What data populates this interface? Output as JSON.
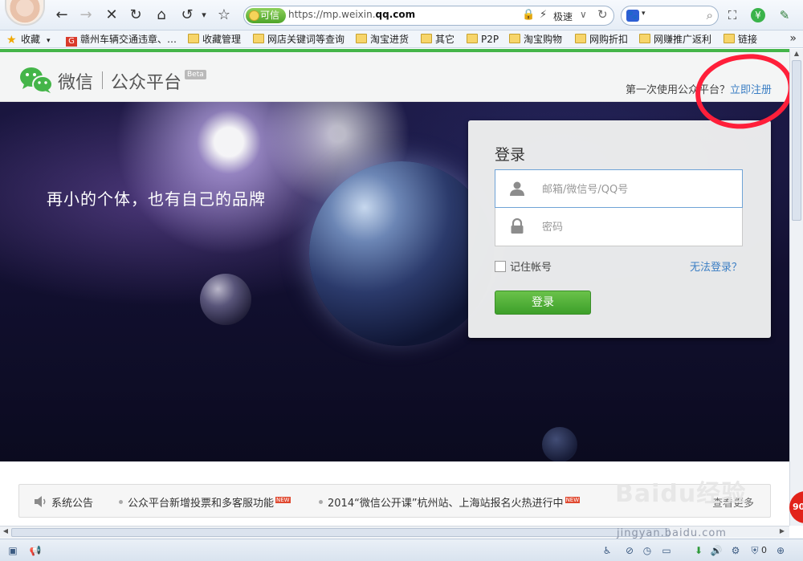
{
  "browser": {
    "trust_label": "可信",
    "url_prefix": "https://mp.weixin.",
    "url_domain": "qq.com",
    "speed_label": "极速",
    "more_label": "»",
    "bookmarks": [
      {
        "label": "收藏",
        "icon": "star-icon"
      },
      {
        "label": "赣州车辆交通违章、…",
        "icon": "g-site-icon"
      },
      {
        "label": "收藏管理",
        "icon": "bookmark-manager-icon"
      },
      {
        "label": "网店关键词等查询",
        "icon": "folder-icon"
      },
      {
        "label": "淘宝进货",
        "icon": "folder-icon"
      },
      {
        "label": "其它",
        "icon": "folder-icon"
      },
      {
        "label": "P2P",
        "icon": "folder-icon"
      },
      {
        "label": "淘宝购物",
        "icon": "folder-icon"
      },
      {
        "label": "网购折扣",
        "icon": "folder-icon"
      },
      {
        "label": "网赚推广返利",
        "icon": "folder-icon"
      },
      {
        "label": "链接",
        "icon": "folder-icon"
      }
    ]
  },
  "header": {
    "brand_name": "微信",
    "brand_sub": "公众平台",
    "beta": "Beta",
    "first_use_text": "第一次使用公众平台？",
    "register_link": "立即注册"
  },
  "hero": {
    "slogan": "再小的个体，也有自己的品牌"
  },
  "login": {
    "title": "登录",
    "username_placeholder": "邮箱/微信号/QQ号",
    "password_placeholder": "密码",
    "remember_label": "记住帐号",
    "cant_login_link": "无法登录？",
    "submit_label": "登录"
  },
  "notices": {
    "title": "系统公告",
    "items": [
      {
        "text": "公众平台新增投票和多客服功能",
        "badge": "NEW"
      },
      {
        "text": "2014“微信公开课”杭州站、上海站报名火热进行中",
        "badge": "NEW"
      }
    ],
    "view_all": "查看更多"
  },
  "overlay": {
    "side_badge": "90",
    "watermark": "Baidu经验",
    "watermark_url": "jingyan.baidu.com",
    "status_count": "0"
  },
  "colors": {
    "accent_green": "#44b549",
    "link_blue": "#3b7ec4",
    "annotation_red": "#ff1f3a"
  }
}
